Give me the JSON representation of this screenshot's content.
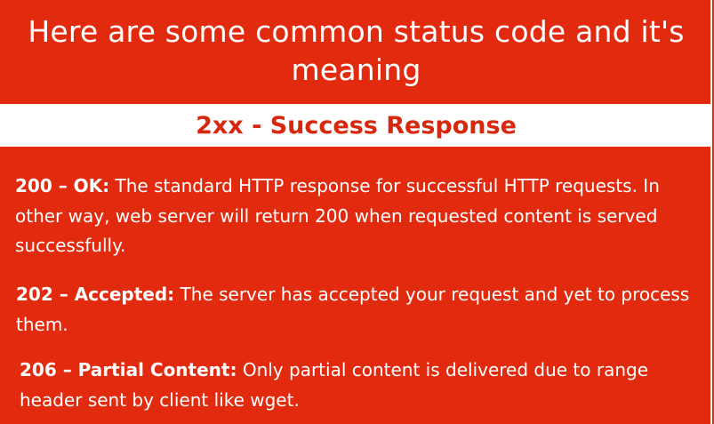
{
  "title": "Here are some common status code and it's meaning",
  "section": {
    "heading": "2xx - Success Response"
  },
  "entries": [
    {
      "code": "200 – OK:",
      "description": "The standard HTTP response for successful HTTP requests. In other way, web server will return 200 when requested content is served successfully."
    },
    {
      "code": "202 – Accepted:",
      "description": "The server has accepted your request and yet to process them."
    },
    {
      "code": "206 – Partial Content:",
      "description": "Only partial content is delivered due to range header sent by client like wget."
    }
  ],
  "colors": {
    "background": "#e22a0e",
    "heading_text": "#d7280e",
    "band": "#ffffff",
    "text": "#ffffff"
  }
}
